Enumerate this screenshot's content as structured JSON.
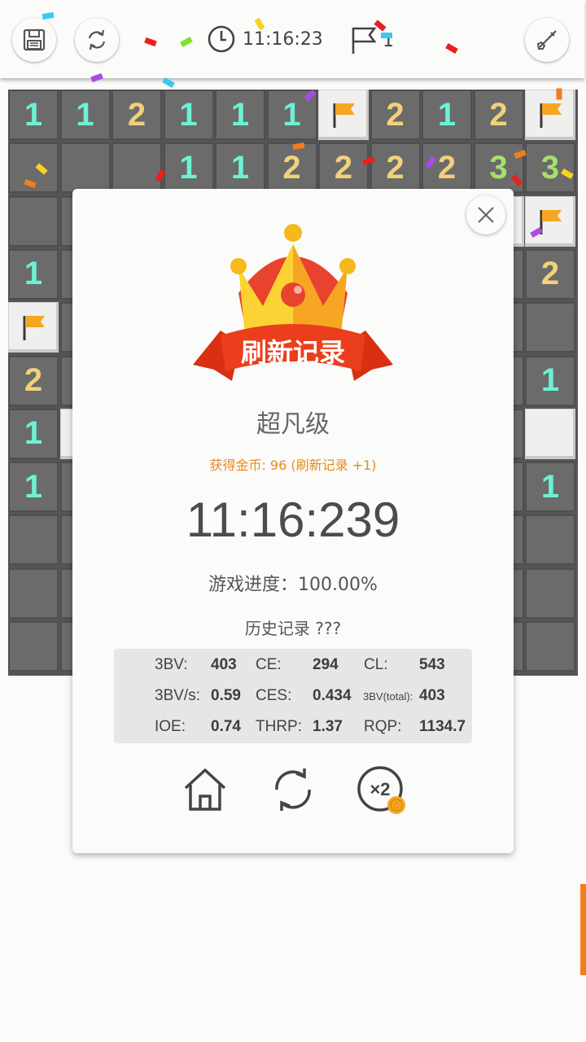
{
  "topbar": {
    "timer": "11:16:23",
    "flag_count": "1",
    "icons": [
      "save-icon",
      "refresh-icon",
      "clock-icon",
      "flag-icon",
      "shovel-icon"
    ]
  },
  "board": {
    "rows": [
      [
        "1",
        "1",
        "2",
        "1",
        "1",
        "1",
        "F",
        "2",
        "1",
        "2",
        "F"
      ],
      [
        "",
        "",
        "",
        "1",
        "1",
        "2",
        "2",
        "2",
        "2",
        "3",
        "3"
      ],
      [
        "",
        "",
        "",
        "",
        "",
        "",
        "",
        "",
        "",
        "U",
        "F"
      ],
      [
        "1",
        "",
        "",
        "",
        "",
        "",
        "",
        "",
        "",
        "",
        "2"
      ],
      [
        "F",
        "",
        "",
        "",
        "",
        "",
        "",
        "",
        "",
        "",
        ""
      ],
      [
        "2",
        "",
        "",
        "",
        "",
        "",
        "",
        "",
        "",
        "",
        "1"
      ],
      [
        "1",
        "U",
        "",
        "",
        "",
        "",
        "",
        "",
        "",
        "",
        "U"
      ],
      [
        "1",
        "",
        "",
        "",
        "",
        "",
        "",
        "",
        "",
        "",
        "1"
      ],
      [
        "",
        "",
        "",
        "",
        "",
        "",
        "",
        "",
        "",
        "",
        ""
      ],
      [
        "",
        "",
        "",
        "",
        "",
        "",
        "",
        "",
        "",
        "",
        ""
      ],
      [
        "",
        "",
        "",
        "",
        "",
        "",
        "",
        "",
        "",
        "",
        ""
      ]
    ],
    "colors": {
      "n1": "#6cf1d6",
      "n2": "#f1d27a",
      "n3": "#a6e06c",
      "flag": "#f5a623"
    }
  },
  "dialog": {
    "banner": "刷新记录",
    "difficulty": "超凡级",
    "coins": "获得金币: 96 (刷新记录 +1)",
    "time": "11:16:239",
    "progress": "游戏进度：100.00%",
    "history": "历史记录 ???",
    "stats": {
      "bv_label": "3BV:",
      "bv": "403",
      "ce_label": "CE:",
      "ce": "294",
      "cl_label": "CL:",
      "cl": "543",
      "bvs_label": "3BV/s:",
      "bvs": "0.59",
      "ces_label": "CES:",
      "ces": "0.434",
      "bvt_label": "3BV(total):",
      "bvt": "403",
      "ioe_label": "IOE:",
      "ioe": "0.74",
      "thrp_label": "THRP:",
      "thrp": "1.37",
      "rqp_label": "RQP:",
      "rqp": "1134.7"
    },
    "buttons": [
      "home-icon",
      "replay-icon",
      "double-coins-icon"
    ],
    "double_label": "×2",
    "coin_label": "C"
  },
  "accent": "#f17d1b"
}
